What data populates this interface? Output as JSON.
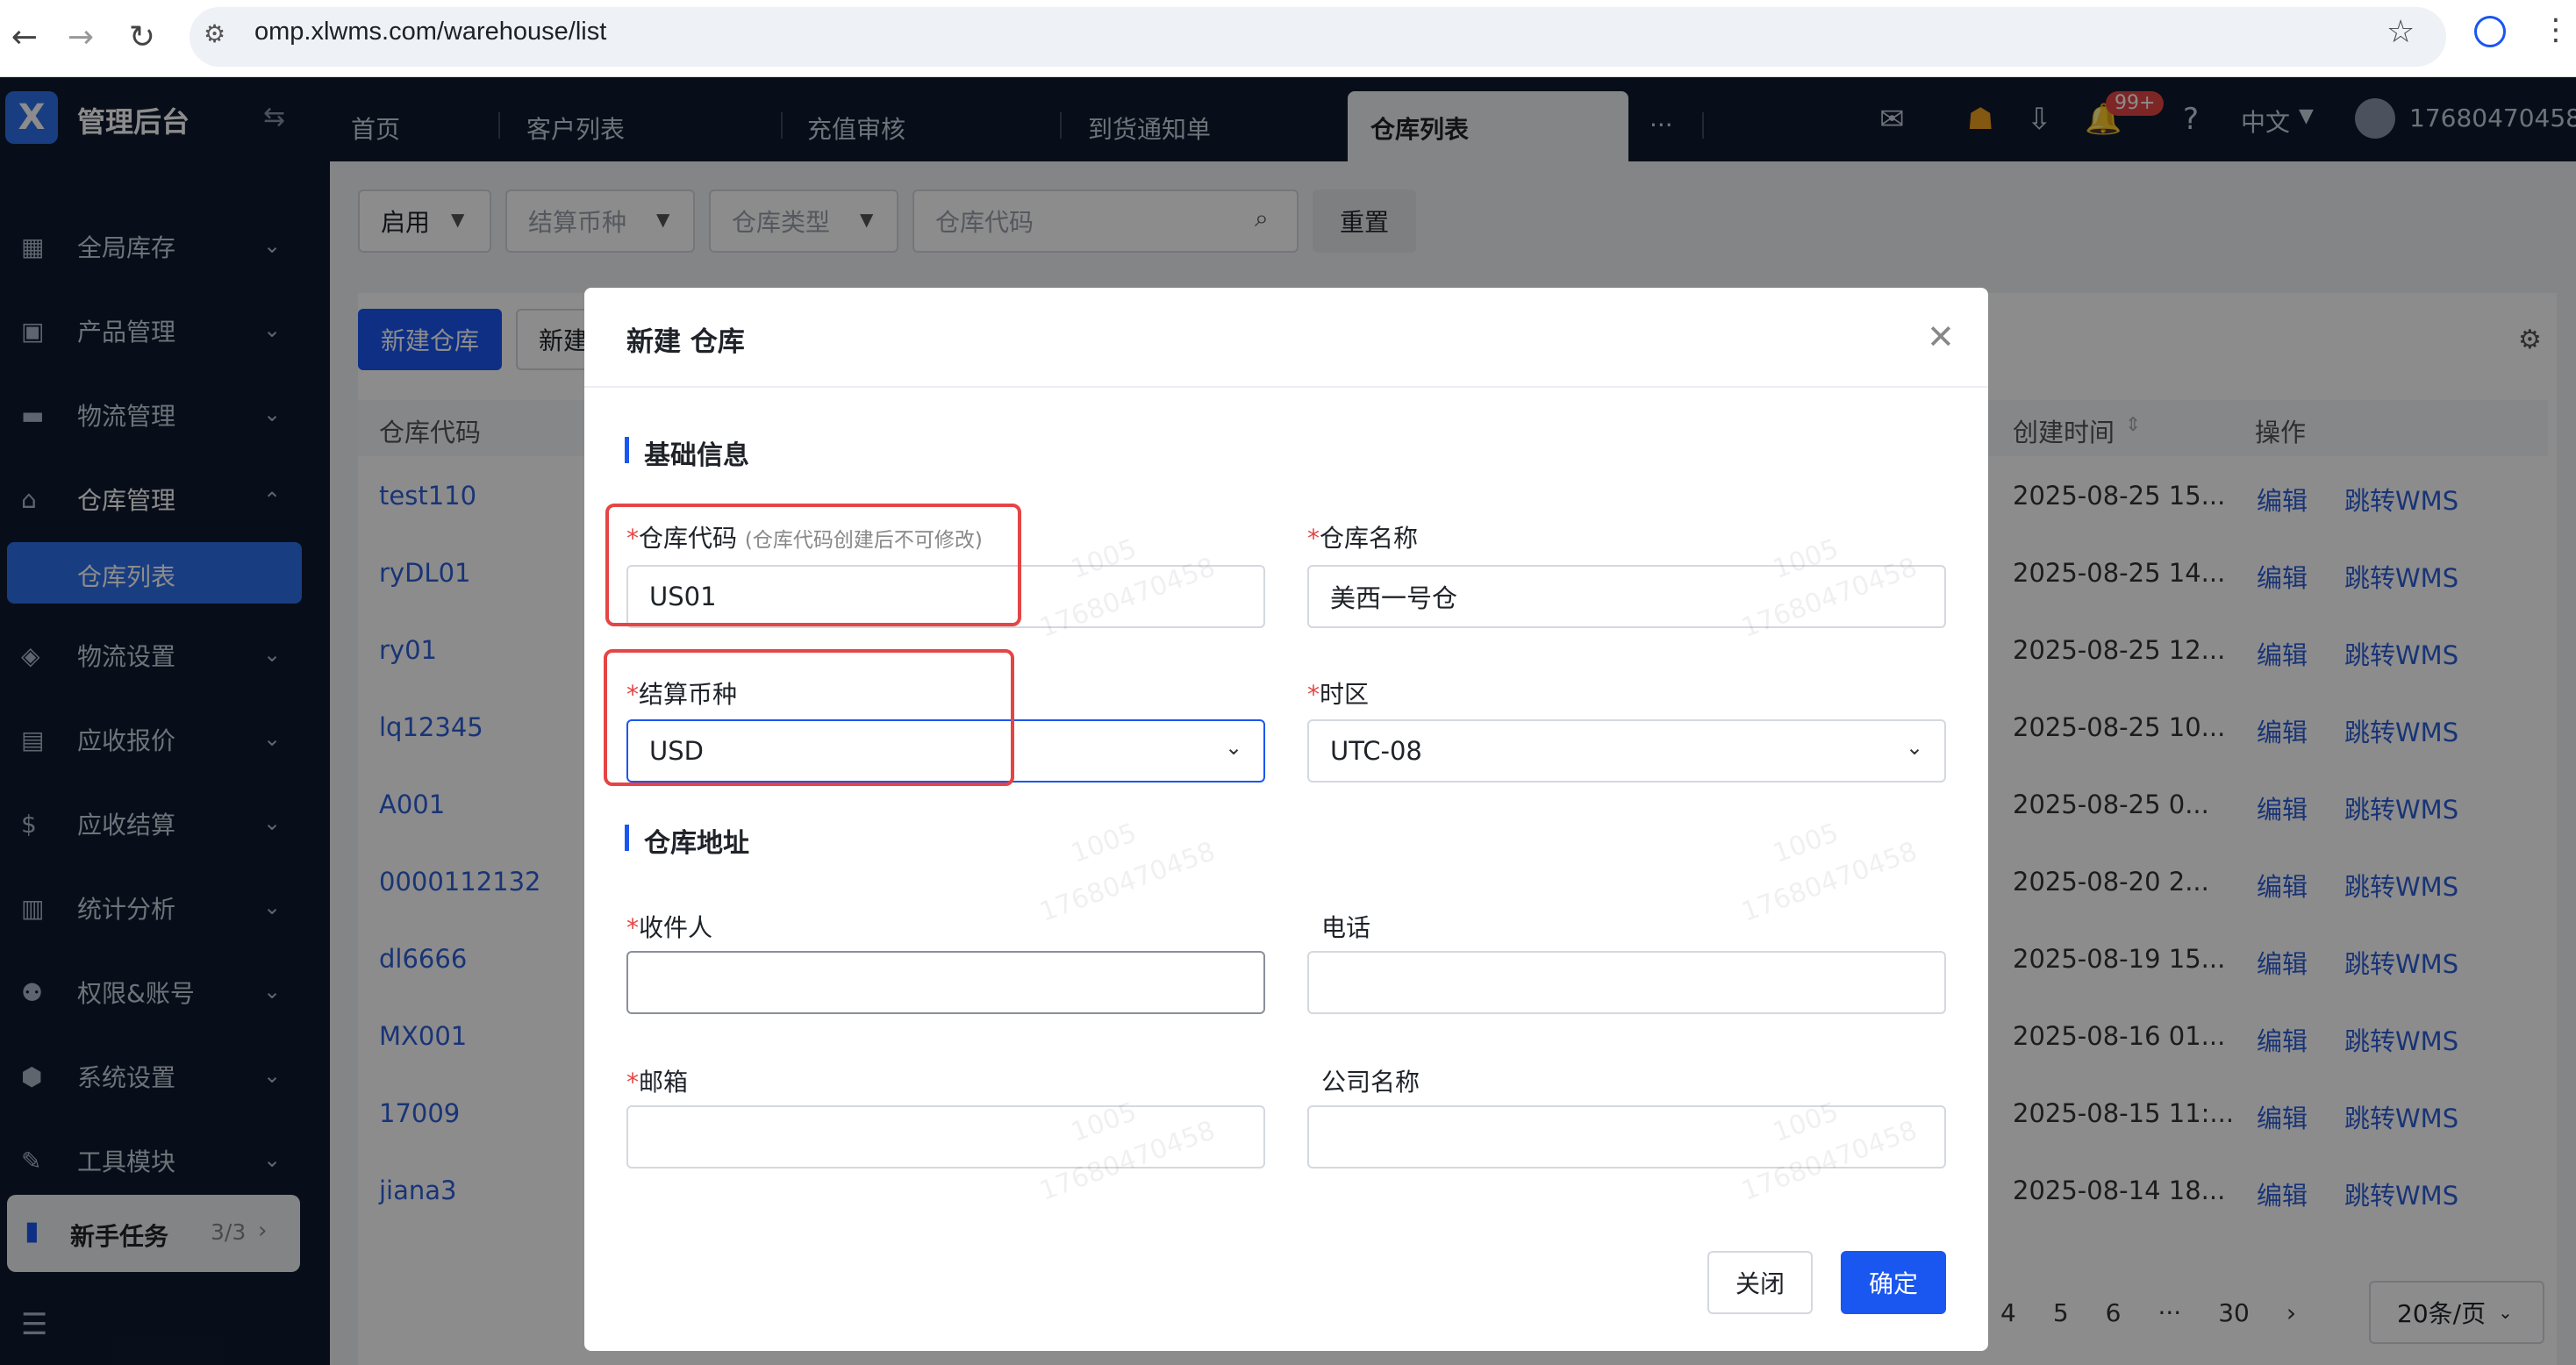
{
  "browser": {
    "url": "omp.xlwms.com/warehouse/list"
  },
  "app": {
    "name": "管理后台",
    "tabs": [
      "首页",
      "客户列表",
      "充值审核",
      "到货通知单",
      "仓库列表"
    ],
    "active_tab": "仓库列表",
    "notif_badge": "99+",
    "language": "中文",
    "user": "17680470458"
  },
  "sidebar": {
    "items": [
      {
        "label": "全局库存",
        "icon": "warehouse-icon"
      },
      {
        "label": "产品管理",
        "icon": "box-icon"
      },
      {
        "label": "物流管理",
        "icon": "truck-icon"
      },
      {
        "label": "仓库管理",
        "icon": "house-icon"
      },
      {
        "label": "物流设置",
        "icon": "package-icon"
      },
      {
        "label": "应收报价",
        "icon": "document-icon"
      },
      {
        "label": "应收结算",
        "icon": "dollar-icon"
      },
      {
        "label": "统计分析",
        "icon": "chart-icon"
      },
      {
        "label": "权限&账号",
        "icon": "org-icon"
      },
      {
        "label": "系统设置",
        "icon": "hexagon-icon"
      },
      {
        "label": "工具模块",
        "icon": "wrench-icon"
      }
    ],
    "sub_active": "仓库列表",
    "task": {
      "label": "新手任务",
      "progress": "3/3"
    }
  },
  "filters": {
    "status": "启用",
    "currency_placeholder": "结算币种",
    "type_placeholder": "仓库类型",
    "code_placeholder": "仓库代码",
    "reset": "重置"
  },
  "actions": {
    "new_warehouse": "新建仓库",
    "new_other": "新建"
  },
  "table": {
    "headers": {
      "code": "仓库代码",
      "created": "创建时间",
      "ops": "操作"
    },
    "edit": "编辑",
    "jump": "跳转WMS",
    "rows": [
      {
        "code": "test110",
        "created": "2025-08-25 15..."
      },
      {
        "code": "ryDL01",
        "created": "2025-08-25 14..."
      },
      {
        "code": "ry01",
        "created": "2025-08-25 12..."
      },
      {
        "code": "lq12345",
        "created": "2025-08-25 10..."
      },
      {
        "code": "A001",
        "created": "2025-08-25 0..."
      },
      {
        "code": "0000112132",
        "created": "2025-08-20 2..."
      },
      {
        "code": "dl6666",
        "created": "2025-08-19 15..."
      },
      {
        "code": "MX001",
        "created": "2025-08-16 01..."
      },
      {
        "code": "17009",
        "created": "2025-08-15 11:..."
      },
      {
        "code": "jiana3",
        "created": "2025-08-14 18..."
      }
    ]
  },
  "pagination": {
    "pages": [
      "4",
      "5",
      "6",
      "···",
      "30"
    ],
    "page_size": "20条/页"
  },
  "modal": {
    "title": "新建 仓库",
    "section_basic": "基础信息",
    "section_address": "仓库地址",
    "code_label": "仓库代码",
    "code_hint": "(仓库代码创建后不可修改)",
    "code_value": "US01",
    "name_label": "仓库名称",
    "name_value": "美西一号仓",
    "currency_label": "结算币种",
    "currency_value": "USD",
    "tz_label": "时区",
    "tz_value": "UTC-08",
    "recipient_label": "收件人",
    "phone_label": "电话",
    "email_label": "邮箱",
    "company_label": "公司名称",
    "close": "关闭",
    "confirm": "确定",
    "watermark_a": "1005",
    "watermark_b": "17680470458"
  },
  "colors": {
    "primary": "#1a56f0",
    "sidebar": "#0f1b2f",
    "highlight": "#e54545"
  }
}
